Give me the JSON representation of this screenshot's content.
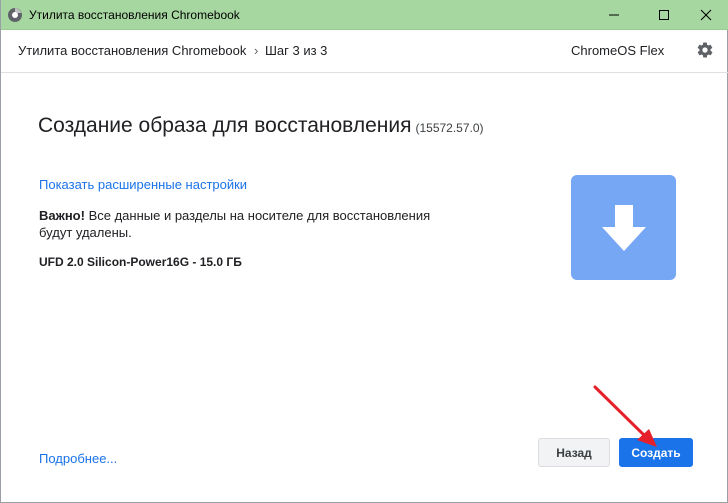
{
  "window": {
    "title": "Утилита восстановления Chromebook",
    "titlebar_color": "#a7d7a0"
  },
  "header": {
    "app_name": "Утилита восстановления Chromebook",
    "separator": "›",
    "step": "Шаг 3 из 3",
    "device": "ChromeOS Flex",
    "settings_icon": "gear-icon"
  },
  "main": {
    "title": "Создание образа для восстановления",
    "version": "(15572.57.0)",
    "advanced_link": "Показать расширенные настройки",
    "warning_bold": "Важно!",
    "warning_text": " Все данные и разделы на носителе для восстановления будут удалены.",
    "drive": "UFD 2.0 Silicon-Power16G - 15.0 ГБ",
    "download_icon": "download-arrow-icon",
    "tile_color": "#75a7f5"
  },
  "footer": {
    "more_link": "Подробнее...",
    "back_label": "Назад",
    "create_label": "Создать",
    "accent": "#1a73e8"
  },
  "annotation": {
    "arrow_color": "#e5202a"
  }
}
